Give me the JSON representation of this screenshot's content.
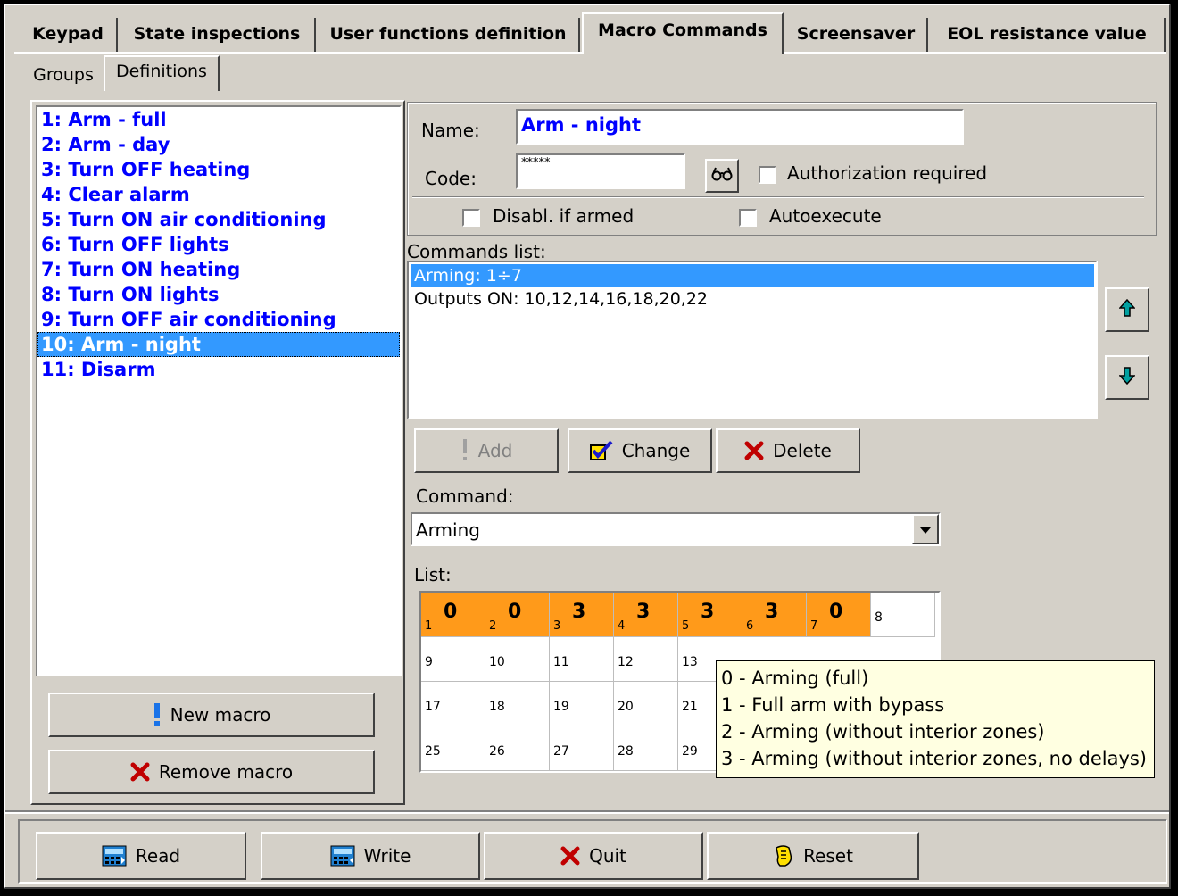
{
  "tabs": [
    "Keypad",
    "State inspections",
    "User functions definition",
    "Macro Commands",
    "Screensaver",
    "EOL resistance value"
  ],
  "subtabs": [
    "Groups",
    "Definitions"
  ],
  "macros": [
    "1: Arm - full",
    "2: Arm - day",
    "3: Turn OFF heating",
    "4: Clear alarm",
    "5: Turn ON air conditioning",
    "6: Turn OFF lights",
    "7: Turn ON heating",
    "8: Turn ON lights",
    "9: Turn OFF air conditioning",
    "10: Arm - night",
    "11: Disarm"
  ],
  "selected_macro": "10: Arm - night",
  "left_buttons": {
    "new_macro": "New macro",
    "remove_macro": "Remove macro"
  },
  "form": {
    "name_label": "Name:",
    "name_value": "Arm - night",
    "code_label": "Code:",
    "code_value": "*****",
    "auth_label": "Authorization required",
    "disabl_label": "Disabl. if armed",
    "autoexec_label": "Autoexecute"
  },
  "commands": {
    "label": "Commands list:",
    "items": [
      "Arming: 1÷7",
      "Outputs ON: 10,12,14,16,18,20,22"
    ]
  },
  "action_buttons": {
    "add": "Add",
    "change": "Change",
    "delete": "Delete"
  },
  "command": {
    "label": "Command:",
    "value": "Arming"
  },
  "list_label": "List:",
  "list_grid": {
    "row1": [
      {
        "n": "1",
        "v": "0"
      },
      {
        "n": "2",
        "v": "0"
      },
      {
        "n": "3",
        "v": "3"
      },
      {
        "n": "4",
        "v": "3"
      },
      {
        "n": "5",
        "v": "3"
      },
      {
        "n": "6",
        "v": "3"
      },
      {
        "n": "7",
        "v": "0"
      },
      {
        "n": "8",
        "v": ""
      }
    ],
    "rows": [
      [
        "9",
        "10",
        "11",
        "12",
        "13"
      ],
      [
        "17",
        "18",
        "19",
        "20",
        "21"
      ],
      [
        "25",
        "26",
        "27",
        "28",
        "29"
      ]
    ]
  },
  "tooltip": [
    "0 - Arming (full)",
    "1 - Full arm with bypass",
    "2 - Arming (without interior zones)",
    "3 - Arming (without interior zones, no delays)"
  ],
  "bottom_buttons": {
    "read": "Read",
    "write": "Write",
    "quit": "Quit",
    "reset": "Reset"
  },
  "colors": {
    "selection": "#3399ff",
    "macro_text": "#0000ff",
    "armed_cell": "#ff9a1a",
    "tooltip_bg": "#ffffe1"
  }
}
